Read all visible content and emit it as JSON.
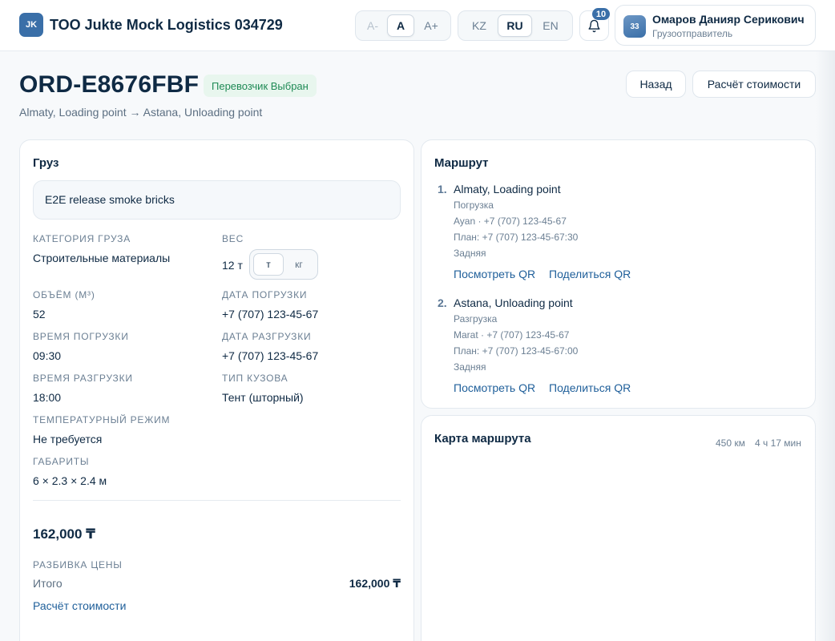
{
  "app": {
    "logo": "JK",
    "title": "TOO Jukte Mock Logistics 034729"
  },
  "font_size": {
    "options": [
      "A-",
      "A",
      "A+"
    ],
    "active": "A"
  },
  "language": {
    "options": [
      "KZ",
      "RU",
      "EN"
    ],
    "active": "RU"
  },
  "notifications": {
    "icon": "bell-icon",
    "count": "10"
  },
  "user": {
    "initials": "33",
    "name": "Омаров Данияр Серикович",
    "role": "Грузоотправитель"
  },
  "order": {
    "id": "ORD-E8676FBF",
    "status": "Перевозчик Выбран",
    "route_from": "Almaty, Loading point",
    "arrow": "→",
    "route_to": "Astana, Unloading point"
  },
  "actions": {
    "back": "Назад",
    "calc": "Расчёт стоимости"
  },
  "cargo": {
    "title": "Груз",
    "description": "E2E release smoke bricks",
    "fields": {
      "category_label": "Категория груза",
      "category": "Строительные материалы",
      "weight_label": "Вес",
      "weight": "12 т",
      "volume_label": "Объём (м³)",
      "volume": "52",
      "loading_date_label": "Дата погрузки",
      "loading_date": "+7 (707) 123-45-67",
      "loading_time_label": "Время погрузки",
      "loading_time": "09:30",
      "unloading_date_label": "Дата разгрузки",
      "unloading_date": "+7 (707) 123-45-67",
      "unloading_time_label": "Время разгрузки",
      "unloading_time": "18:00",
      "body_type_label": "Тип кузова",
      "body_type": "Тент (шторный)",
      "temperature_label": "Температурный режим",
      "temperature": "Не требуется",
      "dimensions_label": "Габариты",
      "dimensions": "6 × 2.3 × 2.4 м"
    },
    "weight_units": {
      "options": [
        "т",
        "кг"
      ],
      "active": "т"
    },
    "price": "162,000 ₸",
    "breakdown_label": "Разбивка цены",
    "total_label": "Итого",
    "total_value": "162,000 ₸",
    "calc_link": "Расчёт стоимости"
  },
  "route": {
    "title": "Маршрут",
    "stops": [
      {
        "num": "1.",
        "title": "Almaty, Loading point",
        "type": "Погрузка",
        "contact": "Ayan · +7 (707) 123-45-67",
        "plan": "План: +7 (707) 123-45-67:30",
        "loading": "Задняя",
        "view_qr": "Посмотреть QR",
        "share_qr": "Поделиться QR"
      },
      {
        "num": "2.",
        "title": "Astana, Unloading point",
        "type": "Разгрузка",
        "contact": "Marat · +7 (707) 123-45-67",
        "plan": "План: +7 (707) 123-45-67:00",
        "loading": "Задняя",
        "view_qr": "Посмотреть QR",
        "share_qr": "Поделиться QR"
      }
    ]
  },
  "map": {
    "title": "Карта маршрута",
    "distance": "450 км",
    "duration": "4 ч 17 мин"
  },
  "colors": {
    "accent": "#3a6fa8",
    "link": "#1f5f9a",
    "status_bg": "#e8f6ee",
    "status_fg": "#1f8a55"
  }
}
